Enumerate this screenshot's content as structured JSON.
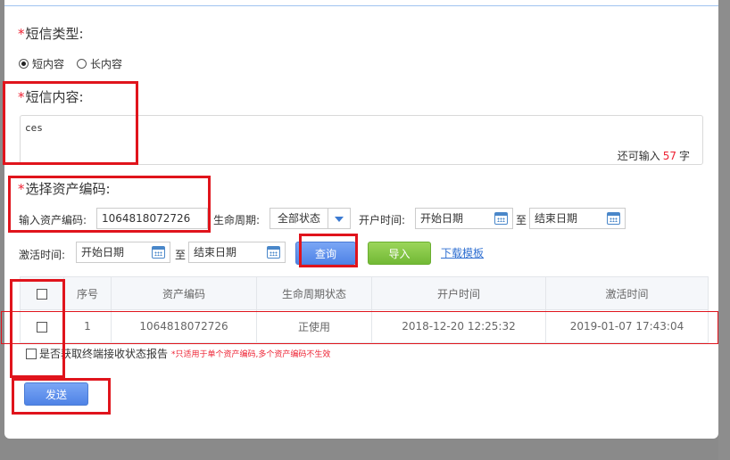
{
  "form": {
    "sms_type": {
      "required_mark": "*",
      "label": "短信类型:",
      "options": [
        "短内容",
        "长内容"
      ],
      "selected": "短内容"
    },
    "sms_content": {
      "required_mark": "*",
      "label": "短信内容:",
      "value": "ces",
      "counter_prefix": "还可输入",
      "counter_value": "57",
      "counter_suffix": "字"
    },
    "asset_code": {
      "required_mark": "*",
      "label": "选择资产编码:"
    }
  },
  "filters": {
    "asset_input_label": "输入资产编码:",
    "asset_input_value": "1064818072726",
    "lifecycle_label": "生命周期:",
    "lifecycle_value": "全部状态",
    "open_time_label": "开户时间:",
    "open_start_placeholder": "开始日期",
    "to_label": "至",
    "open_end_placeholder": "结束日期",
    "activate_time_label": "激活时间:",
    "activate_start_placeholder": "开始日期",
    "activate_end_placeholder": "结束日期",
    "query_button": "查询",
    "import_button": "导入",
    "download_link": "下载模板"
  },
  "table": {
    "columns": [
      "序号",
      "资产编码",
      "生命周期状态",
      "开户时间",
      "激活时间"
    ],
    "rows": [
      [
        "1",
        "1064818072726",
        "正使用",
        "2018-12-20 12:25:32",
        "2019-01-07 17:43:04"
      ]
    ]
  },
  "report": {
    "label": "是否获取终端接收状态报告",
    "note": "*只适用于单个资产编码,多个资产编码不生效"
  },
  "send_button": "发送",
  "colors": {
    "accent_blue": "#4f83e6",
    "green": "#72b935",
    "required_red": "#e23",
    "annotation_red": "#e0141c"
  }
}
